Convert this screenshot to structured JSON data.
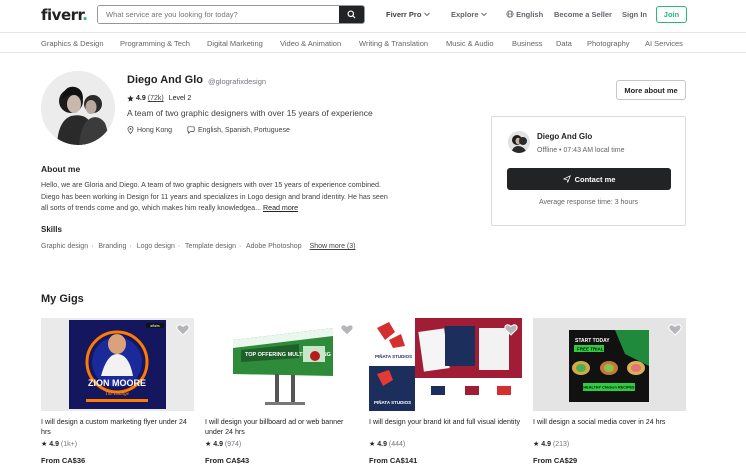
{
  "header": {
    "logo_text": "fiverr",
    "logo_dot": ".",
    "search_placeholder": "What service are you looking for today?",
    "nav": [
      "Fiverr Pro",
      "Explore",
      "English",
      "Become a Seller",
      "Sign In"
    ],
    "join_label": "Join"
  },
  "categories": [
    "Graphics & Design",
    "Programming & Tech",
    "Digital Marketing",
    "Video & Animation",
    "Writing & Translation",
    "Music & Audio",
    "Business",
    "Data",
    "Photography",
    "AI Services"
  ],
  "profile": {
    "name": "Diego And Glo",
    "username": "@glografixdesign",
    "rating": "4.9",
    "rating_count": "(72k)",
    "level": "Level 2",
    "tagline": "A team of two graphic designers with over 15 years of experience",
    "location": "Hong Kong",
    "languages": "English, Spanish, Portuguese",
    "more_about_label": "More about me"
  },
  "contact": {
    "name": "Diego And Glo",
    "status": "Offline • 07:43 AM local time",
    "button_label": "Contact me",
    "response": "Average response time: 3 hours"
  },
  "about": {
    "heading": "About me",
    "text": "Hello, we are Gloria and Diego. A team of two graphic designers with over 15 years of experience combined. Diego has been working in Design for 11 years and specializes in Logo design and brand identity. He has seen all sorts of trends come and go, which makes him really knowledgea...",
    "read_more": "Read more",
    "skills_heading": "Skills",
    "skills": [
      "Graphic design",
      "Branding",
      "Logo design",
      "Template design",
      "Adobe Photoshop"
    ],
    "show_more": "Show more (3)"
  },
  "gigs_heading": "My Gigs",
  "gigs": [
    {
      "title": "I will design a custom marketing flyer under 24 hrs",
      "rating": "4.9",
      "count": "(1k+)",
      "price": "From CA$36",
      "img_text1": "ZION MOORE",
      "img_text2": "The Lounge",
      "img_badge": "affairs"
    },
    {
      "title": "I will design your billboard ad or web banner under 24 hrs",
      "rating": "4.9",
      "count": "(974)",
      "price": "From CA$43",
      "img_text1": "TOP OFFERING MULTI-TURNING"
    },
    {
      "title": "I will design your brand kit and full visual identity",
      "rating": "4.9",
      "count": "(444)",
      "price": "From CA$141",
      "img_text1": "PIÑATA STUDIOS",
      "img_text2": "PIÑATA STUDIOS"
    },
    {
      "title": "I will design a social media cover in 24 hrs",
      "rating": "4.9",
      "count": "(213)",
      "price": "From CA$29",
      "img_text1": "START TODAY",
      "img_text2": "FREE TRIAL",
      "img_text3": "HEALTHY Chicken RECIPES"
    }
  ]
}
